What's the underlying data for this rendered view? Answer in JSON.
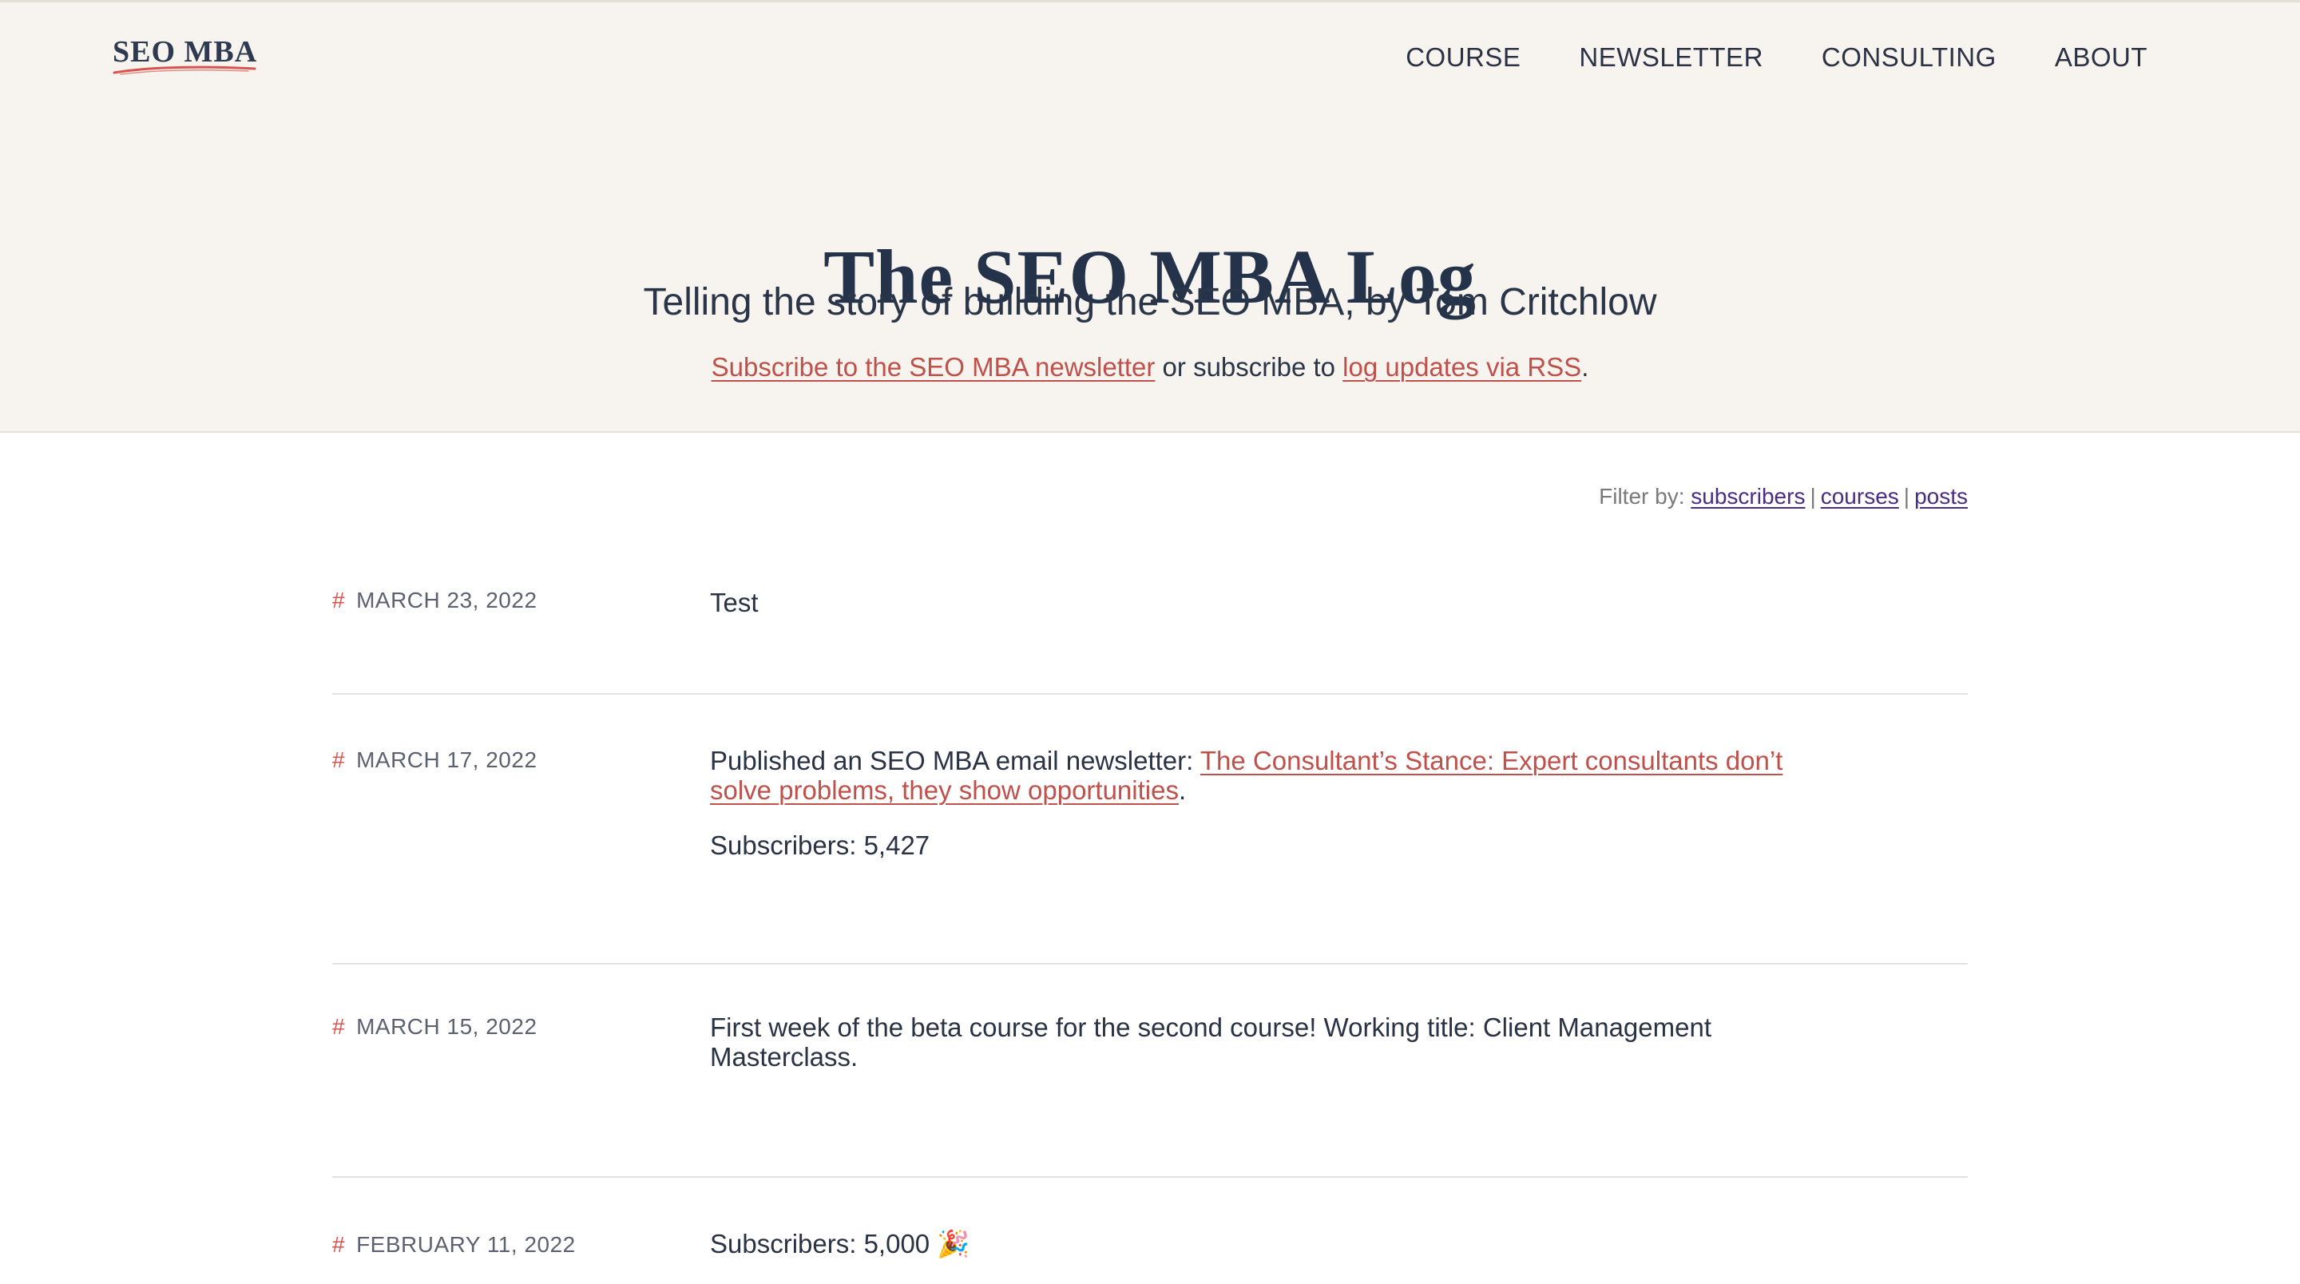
{
  "logo": {
    "text": "SEO MBA"
  },
  "nav": {
    "items": [
      "COURSE",
      "NEWSLETTER",
      "CONSULTING",
      "ABOUT"
    ]
  },
  "hero": {
    "title": "The SEO MBA Log",
    "subtitle": "Telling the story of building the SEO MBA, by Tom Critchlow",
    "subscribe_link": "Subscribe to the SEO MBA newsletter",
    "subscribe_middle": " or subscribe to ",
    "rss_link": "log updates via RSS",
    "subscribe_end": "."
  },
  "filter": {
    "label": "Filter by: ",
    "options": [
      "subscribers",
      "courses",
      "posts"
    ],
    "separator": "|"
  },
  "entries": [
    {
      "hash": "#",
      "date": "MARCH 23, 2022",
      "text": "Test"
    },
    {
      "hash": "#",
      "date": "MARCH 17, 2022",
      "text_prefix": "Published an SEO MBA email newsletter: ",
      "link": "The Consultant’s Stance: Expert consultants don’t solve problems, they show opportunities",
      "text_suffix": ".",
      "second_line": "Subscribers: 5,427"
    },
    {
      "hash": "#",
      "date": "MARCH 15, 2022",
      "text": "First week of the beta course for the second course! Working title: Client Management Masterclass."
    },
    {
      "hash": "#",
      "date": "FEBRUARY 11, 2022",
      "text": "Subscribers: 5,000 🎉"
    }
  ],
  "colors": {
    "hero_bg": "#f7f4f0",
    "accent_red": "#c0504a",
    "filter_link": "#4a2c85",
    "text_dark": "#24324a"
  }
}
